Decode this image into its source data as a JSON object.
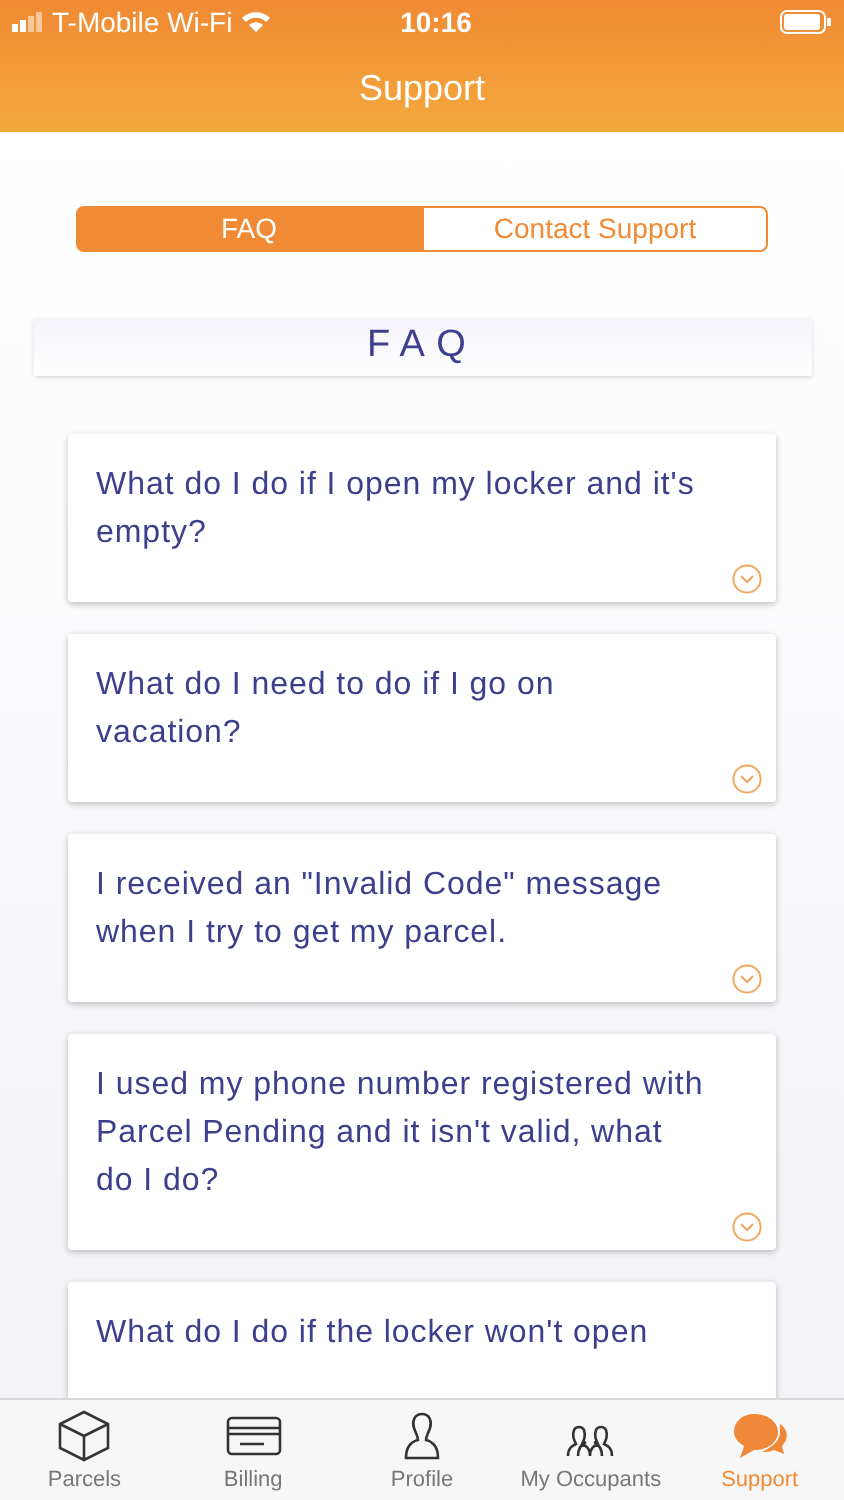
{
  "status_bar": {
    "carrier": "T-Mobile Wi-Fi",
    "time": "10:16"
  },
  "header": {
    "title": "Support"
  },
  "segments": [
    {
      "label": "FAQ",
      "selected": true
    },
    {
      "label": "Contact Support",
      "selected": false
    }
  ],
  "section_title": "FAQ",
  "questions": [
    {
      "text": "What do I do if I open my locker and it's empty?",
      "expanded": false
    },
    {
      "text": "What do I need to do if I go on vacation?",
      "expanded": false
    },
    {
      "text": "I received an \"Invalid Code\" message when I try to get my parcel.",
      "expanded": false
    },
    {
      "text": "I used my phone number registered with Parcel Pending and it isn't valid, what do I do?",
      "expanded": false
    },
    {
      "text": "What do I do if the locker won't open"
    }
  ],
  "tab_bar": [
    {
      "label": "Parcels",
      "kind": "box",
      "selected": false
    },
    {
      "label": "Billing",
      "kind": "card",
      "selected": false
    },
    {
      "label": "Profile",
      "kind": "person",
      "selected": false
    },
    {
      "label": "My Occupants",
      "kind": "people",
      "selected": false
    },
    {
      "label": "Support",
      "kind": "chat",
      "selected": true
    }
  ]
}
